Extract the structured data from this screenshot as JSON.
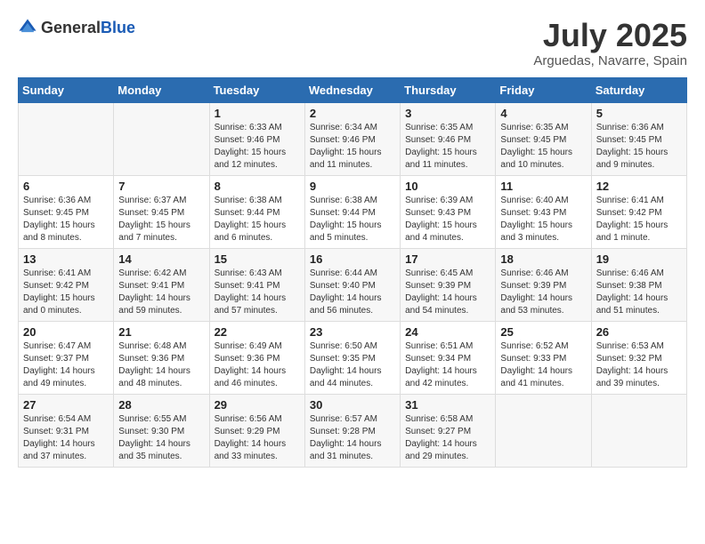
{
  "logo": {
    "general": "General",
    "blue": "Blue"
  },
  "title": "July 2025",
  "location": "Arguedas, Navarre, Spain",
  "weekdays": [
    "Sunday",
    "Monday",
    "Tuesday",
    "Wednesday",
    "Thursday",
    "Friday",
    "Saturday"
  ],
  "weeks": [
    [
      {
        "day": "",
        "info": ""
      },
      {
        "day": "",
        "info": ""
      },
      {
        "day": "1",
        "info": "Sunrise: 6:33 AM\nSunset: 9:46 PM\nDaylight: 15 hours and 12 minutes."
      },
      {
        "day": "2",
        "info": "Sunrise: 6:34 AM\nSunset: 9:46 PM\nDaylight: 15 hours and 11 minutes."
      },
      {
        "day": "3",
        "info": "Sunrise: 6:35 AM\nSunset: 9:46 PM\nDaylight: 15 hours and 11 minutes."
      },
      {
        "day": "4",
        "info": "Sunrise: 6:35 AM\nSunset: 9:45 PM\nDaylight: 15 hours and 10 minutes."
      },
      {
        "day": "5",
        "info": "Sunrise: 6:36 AM\nSunset: 9:45 PM\nDaylight: 15 hours and 9 minutes."
      }
    ],
    [
      {
        "day": "6",
        "info": "Sunrise: 6:36 AM\nSunset: 9:45 PM\nDaylight: 15 hours and 8 minutes."
      },
      {
        "day": "7",
        "info": "Sunrise: 6:37 AM\nSunset: 9:45 PM\nDaylight: 15 hours and 7 minutes."
      },
      {
        "day": "8",
        "info": "Sunrise: 6:38 AM\nSunset: 9:44 PM\nDaylight: 15 hours and 6 minutes."
      },
      {
        "day": "9",
        "info": "Sunrise: 6:38 AM\nSunset: 9:44 PM\nDaylight: 15 hours and 5 minutes."
      },
      {
        "day": "10",
        "info": "Sunrise: 6:39 AM\nSunset: 9:43 PM\nDaylight: 15 hours and 4 minutes."
      },
      {
        "day": "11",
        "info": "Sunrise: 6:40 AM\nSunset: 9:43 PM\nDaylight: 15 hours and 3 minutes."
      },
      {
        "day": "12",
        "info": "Sunrise: 6:41 AM\nSunset: 9:42 PM\nDaylight: 15 hours and 1 minute."
      }
    ],
    [
      {
        "day": "13",
        "info": "Sunrise: 6:41 AM\nSunset: 9:42 PM\nDaylight: 15 hours and 0 minutes."
      },
      {
        "day": "14",
        "info": "Sunrise: 6:42 AM\nSunset: 9:41 PM\nDaylight: 14 hours and 59 minutes."
      },
      {
        "day": "15",
        "info": "Sunrise: 6:43 AM\nSunset: 9:41 PM\nDaylight: 14 hours and 57 minutes."
      },
      {
        "day": "16",
        "info": "Sunrise: 6:44 AM\nSunset: 9:40 PM\nDaylight: 14 hours and 56 minutes."
      },
      {
        "day": "17",
        "info": "Sunrise: 6:45 AM\nSunset: 9:39 PM\nDaylight: 14 hours and 54 minutes."
      },
      {
        "day": "18",
        "info": "Sunrise: 6:46 AM\nSunset: 9:39 PM\nDaylight: 14 hours and 53 minutes."
      },
      {
        "day": "19",
        "info": "Sunrise: 6:46 AM\nSunset: 9:38 PM\nDaylight: 14 hours and 51 minutes."
      }
    ],
    [
      {
        "day": "20",
        "info": "Sunrise: 6:47 AM\nSunset: 9:37 PM\nDaylight: 14 hours and 49 minutes."
      },
      {
        "day": "21",
        "info": "Sunrise: 6:48 AM\nSunset: 9:36 PM\nDaylight: 14 hours and 48 minutes."
      },
      {
        "day": "22",
        "info": "Sunrise: 6:49 AM\nSunset: 9:36 PM\nDaylight: 14 hours and 46 minutes."
      },
      {
        "day": "23",
        "info": "Sunrise: 6:50 AM\nSunset: 9:35 PM\nDaylight: 14 hours and 44 minutes."
      },
      {
        "day": "24",
        "info": "Sunrise: 6:51 AM\nSunset: 9:34 PM\nDaylight: 14 hours and 42 minutes."
      },
      {
        "day": "25",
        "info": "Sunrise: 6:52 AM\nSunset: 9:33 PM\nDaylight: 14 hours and 41 minutes."
      },
      {
        "day": "26",
        "info": "Sunrise: 6:53 AM\nSunset: 9:32 PM\nDaylight: 14 hours and 39 minutes."
      }
    ],
    [
      {
        "day": "27",
        "info": "Sunrise: 6:54 AM\nSunset: 9:31 PM\nDaylight: 14 hours and 37 minutes."
      },
      {
        "day": "28",
        "info": "Sunrise: 6:55 AM\nSunset: 9:30 PM\nDaylight: 14 hours and 35 minutes."
      },
      {
        "day": "29",
        "info": "Sunrise: 6:56 AM\nSunset: 9:29 PM\nDaylight: 14 hours and 33 minutes."
      },
      {
        "day": "30",
        "info": "Sunrise: 6:57 AM\nSunset: 9:28 PM\nDaylight: 14 hours and 31 minutes."
      },
      {
        "day": "31",
        "info": "Sunrise: 6:58 AM\nSunset: 9:27 PM\nDaylight: 14 hours and 29 minutes."
      },
      {
        "day": "",
        "info": ""
      },
      {
        "day": "",
        "info": ""
      }
    ]
  ]
}
